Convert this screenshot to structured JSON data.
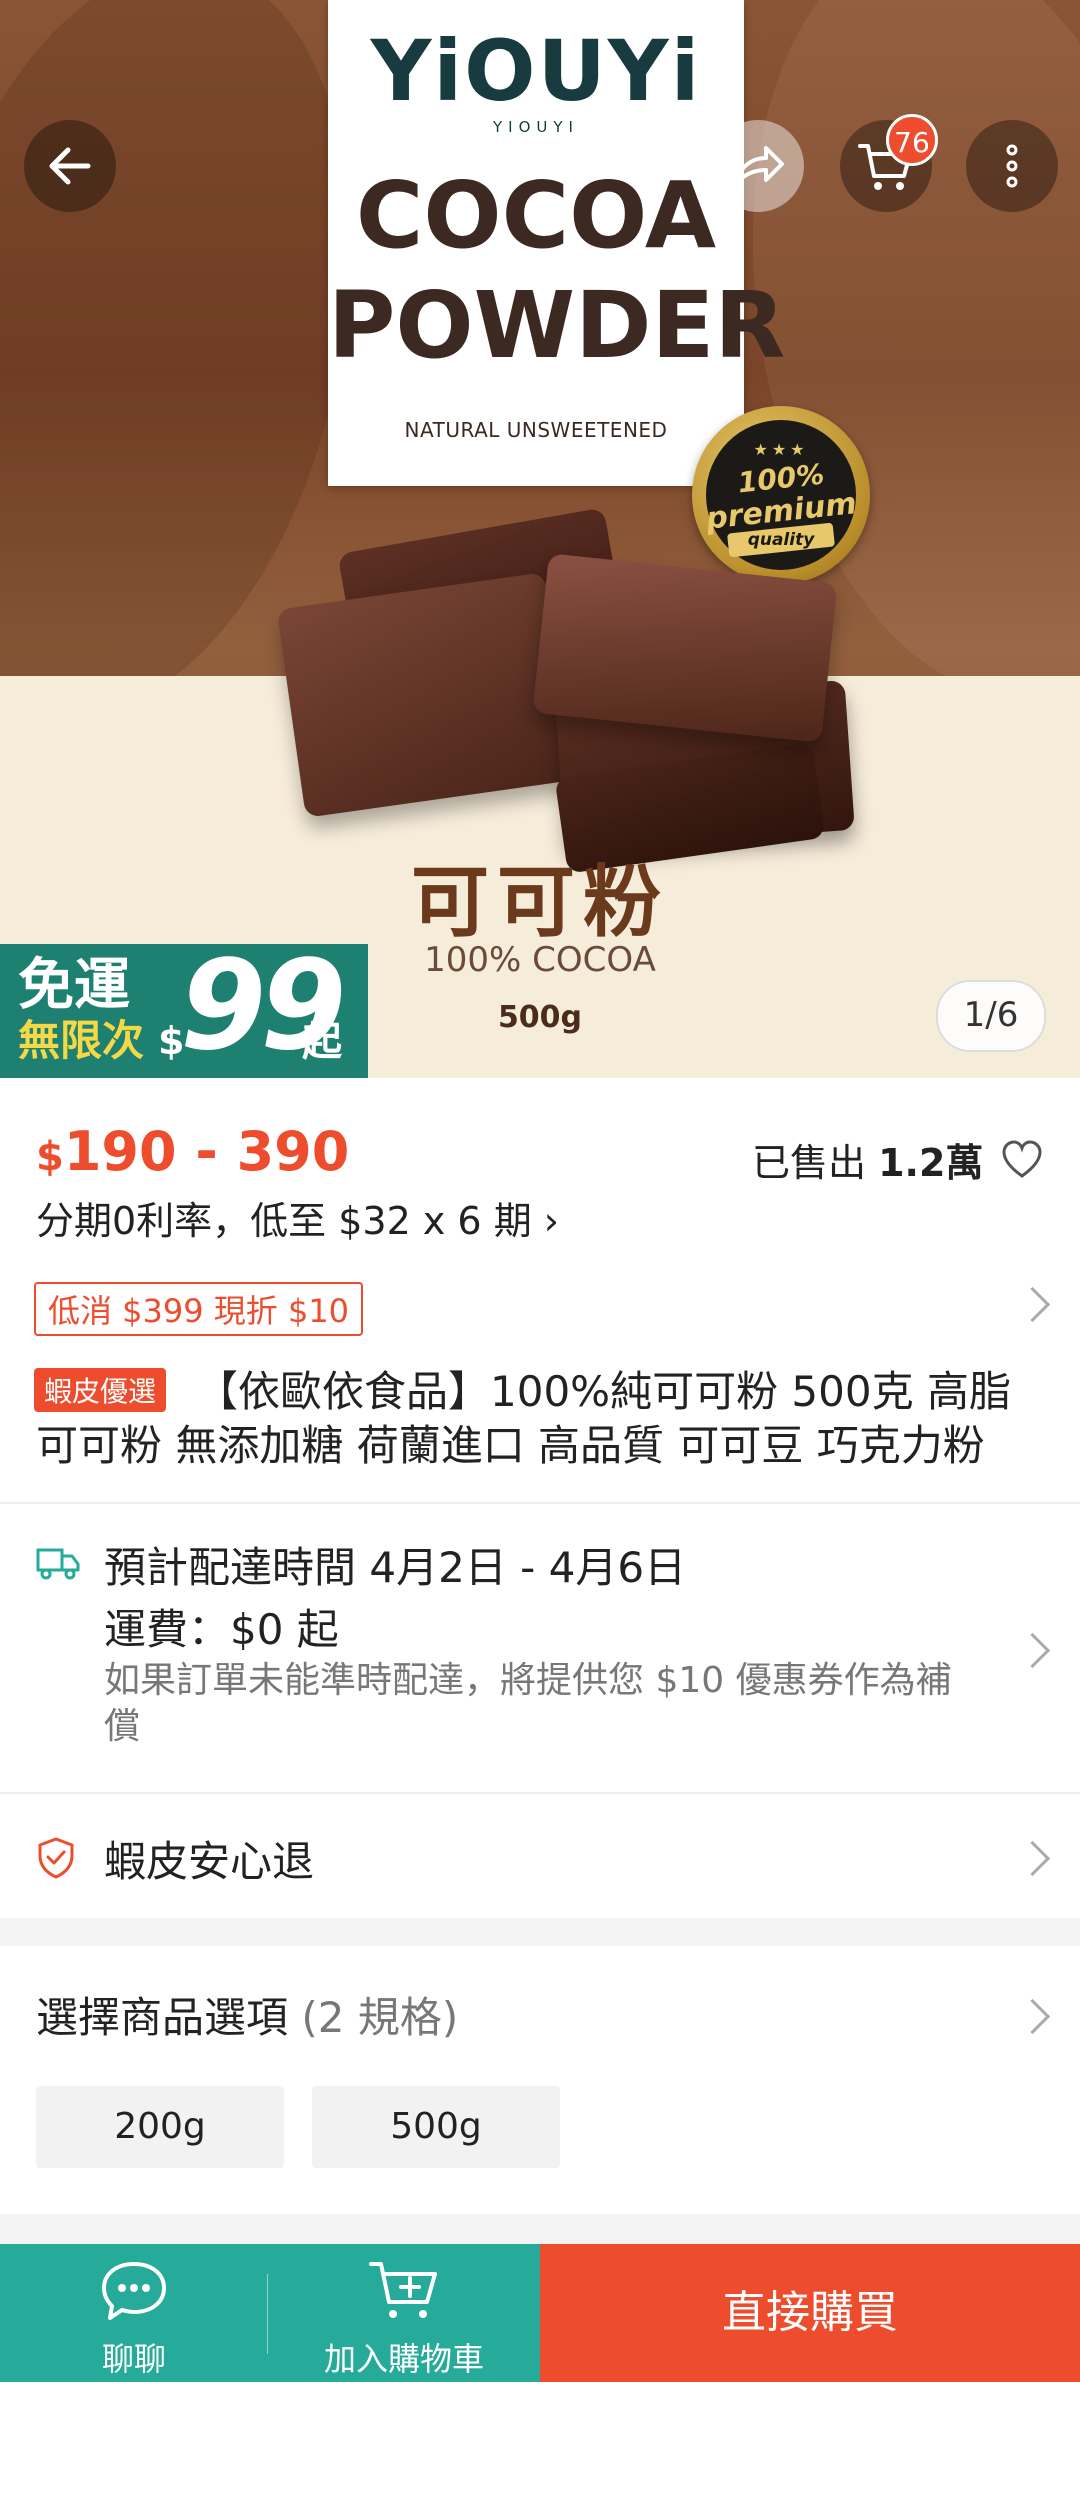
{
  "hero": {
    "brand": "YiOUYi",
    "brand_sub": "YIOUYI",
    "box_title_1": "COCOA",
    "box_title_2": "POWDER",
    "box_subtitle": "NATURAL UNSWEETENED",
    "seal_stars": "★★★",
    "seal_line1": "100%",
    "seal_line2": "premium",
    "seal_line3": "quality",
    "cn_title": "可可粉",
    "cocoa_line": "100% COCOA",
    "weight": "500g",
    "pager": "1/6",
    "cart_count": "76",
    "shipping_badge": {
      "line1": "免運",
      "line2": "無限次",
      "dollar": "$",
      "number": "99",
      "suffix": "起"
    }
  },
  "product": {
    "price_currency": "$",
    "price_range": "190 - 390",
    "sold_label": "已售出",
    "sold_count": "1.2萬",
    "installment": "分期0利率，低至 $32 x 6 期 ›",
    "coupon": "低消 $399 現折 $10",
    "preferred_tag": "蝦皮優選",
    "title_line1": "【依歐依食品】100%純可可粉 500克 高脂",
    "title_line2": "可可粉 無添加糖 荷蘭進口 高品質 可可豆 巧克力粉"
  },
  "delivery": {
    "estimate": "預計配達時間 4月2日 - 4月6日",
    "fee": "運費：$0 起",
    "guarantee": "如果訂單未能準時配達，將提供您 $10 優惠券作為補償"
  },
  "returns": {
    "label": "蝦皮安心退"
  },
  "options": {
    "heading": "選擇商品選項",
    "count": "(2 規格)",
    "items": [
      "200g",
      "500g"
    ]
  },
  "bottom_bar": {
    "chat": "聊聊",
    "add_to_cart": "加入購物車",
    "buy_now": "直接購買"
  },
  "colors": {
    "accent": "#ee4d2d",
    "teal": "#26aa99",
    "badge_green": "#1d8071"
  },
  "icons": [
    "back-arrow-icon",
    "share-icon",
    "cart-icon",
    "more-icon",
    "heart-icon",
    "truck-icon",
    "shield-icon",
    "chat-icon",
    "add-cart-icon",
    "chevron-right-icon"
  ]
}
